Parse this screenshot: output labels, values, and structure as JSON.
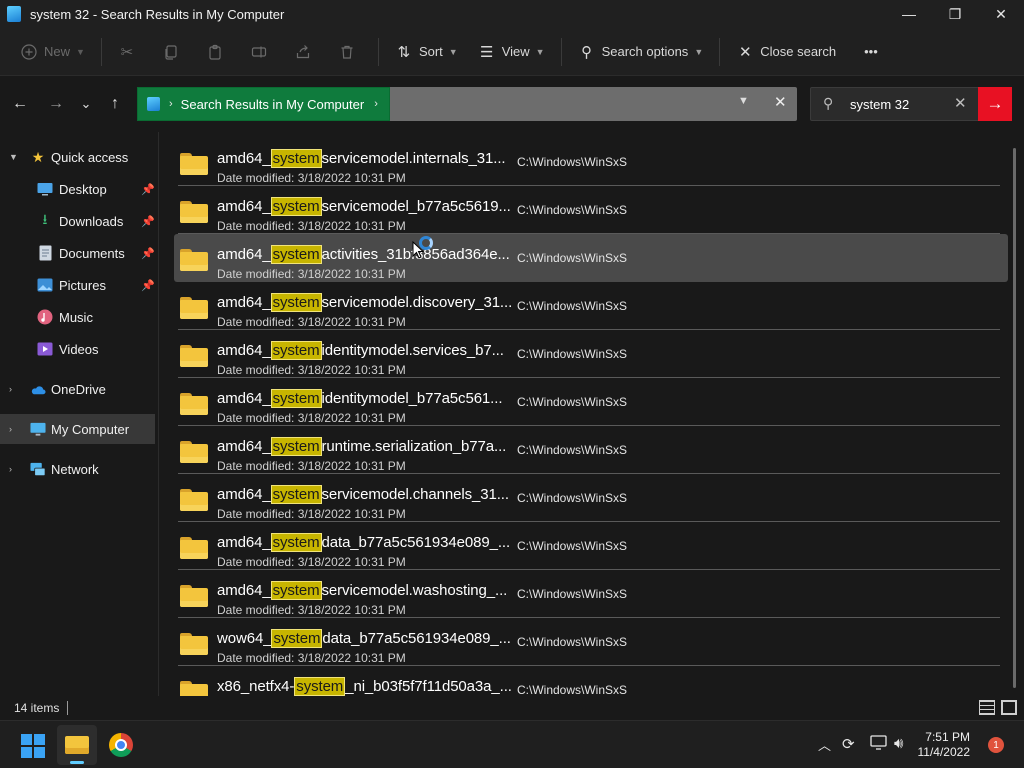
{
  "window": {
    "title": "system 32 - Search Results in My Computer",
    "minimize": "—",
    "maximize": "❐",
    "close": "✕"
  },
  "toolbar": {
    "new_label": "New",
    "sort_label": "Sort",
    "view_label": "View",
    "search_options_label": "Search options",
    "close_search_label": "Close search",
    "more": "•••"
  },
  "nav": {
    "back": "←",
    "forward": "→",
    "recent": "⌄",
    "up": "↑"
  },
  "address": {
    "crumb": "Search Results in My Computer"
  },
  "search": {
    "value": "system 32"
  },
  "sidebar": {
    "items": [
      {
        "label": "Quick access"
      },
      {
        "label": "Desktop"
      },
      {
        "label": "Downloads"
      },
      {
        "label": "Documents"
      },
      {
        "label": "Pictures"
      },
      {
        "label": "Music"
      },
      {
        "label": "Videos"
      },
      {
        "label": "OneDrive"
      },
      {
        "label": "My Computer"
      },
      {
        "label": "Network"
      }
    ]
  },
  "results": {
    "match": "system",
    "items": [
      {
        "prefix": "amd64_",
        "suffix": "servicemodel.internals_31...",
        "date": "Date modified: 3/18/2022 10:31 PM",
        "path": "C:\\Windows\\WinSxS"
      },
      {
        "prefix": "amd64_",
        "suffix": "servicemodel_b77a5c5619...",
        "date": "Date modified: 3/18/2022 10:31 PM",
        "path": "C:\\Windows\\WinSxS"
      },
      {
        "prefix": "amd64_",
        "suffix": "activities_31bf3856ad364e...",
        "date": "Date modified: 3/18/2022 10:31 PM",
        "path": "C:\\Windows\\WinSxS"
      },
      {
        "prefix": "amd64_",
        "suffix": "servicemodel.discovery_31...",
        "date": "Date modified: 3/18/2022 10:31 PM",
        "path": "C:\\Windows\\WinSxS"
      },
      {
        "prefix": "amd64_",
        "suffix": "identitymodel.services_b7...",
        "date": "Date modified: 3/18/2022 10:31 PM",
        "path": "C:\\Windows\\WinSxS"
      },
      {
        "prefix": "amd64_",
        "suffix": "identitymodel_b77a5c561...",
        "date": "Date modified: 3/18/2022 10:31 PM",
        "path": "C:\\Windows\\WinSxS"
      },
      {
        "prefix": "amd64_",
        "suffix": "runtime.serialization_b77a...",
        "date": "Date modified: 3/18/2022 10:31 PM",
        "path": "C:\\Windows\\WinSxS"
      },
      {
        "prefix": "amd64_",
        "suffix": "servicemodel.channels_31...",
        "date": "Date modified: 3/18/2022 10:31 PM",
        "path": "C:\\Windows\\WinSxS"
      },
      {
        "prefix": "amd64_",
        "suffix": "data_b77a5c561934e089_...",
        "date": "Date modified: 3/18/2022 10:31 PM",
        "path": "C:\\Windows\\WinSxS"
      },
      {
        "prefix": "amd64_",
        "suffix": "servicemodel.washosting_...",
        "date": "Date modified: 3/18/2022 10:31 PM",
        "path": "C:\\Windows\\WinSxS"
      },
      {
        "prefix": "wow64_",
        "suffix": "data_b77a5c561934e089_...",
        "date": "Date modified: 3/18/2022 10:31 PM",
        "path": "C:\\Windows\\WinSxS"
      },
      {
        "prefix": "x86_netfx4-",
        "suffix": "_ni_b03f5f7f11d50a3a_...",
        "date": "",
        "path": "C:\\Windows\\WinSxS"
      }
    ]
  },
  "status": {
    "count": "14 items"
  },
  "taskbar": {
    "time": "7:51 PM",
    "date": "11/4/2022",
    "notifications": "1"
  }
}
